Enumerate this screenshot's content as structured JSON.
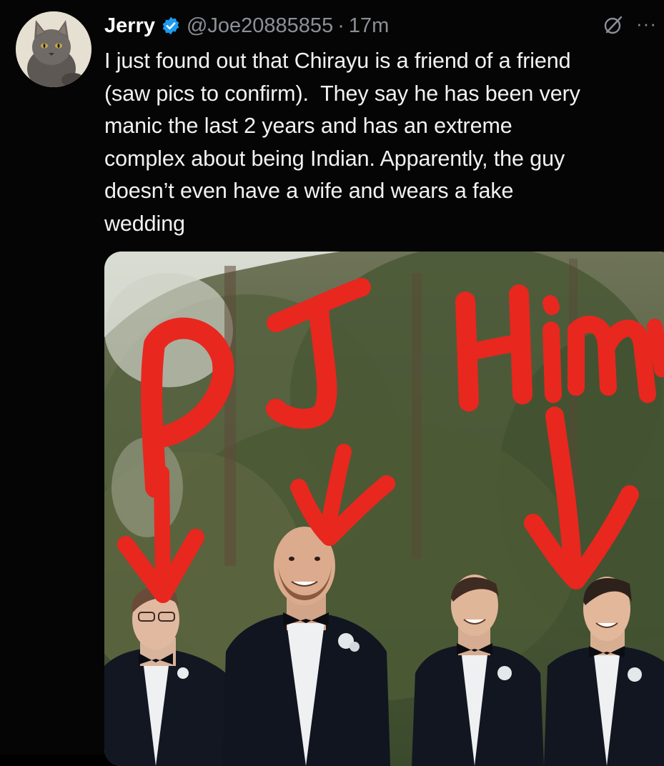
{
  "tweet": {
    "author_name": "Jerry",
    "handle": "@Joe20885855",
    "separator": "·",
    "time": "17m",
    "more_label": "···",
    "text": "I just found out that Chirayu is a friend of a friend\n(saw pics to confirm).  They say he has been very\nmanic the last 2 years and has an extreme\ncomplex about being Indian. Apparently, the guy\ndoesn’t even have a wife and wears a fake\nwedding",
    "verified_color": "#1d9bf0",
    "media": {
      "annotations": [
        "P",
        "J",
        "Him"
      ],
      "annotation_color": "#e8271f"
    }
  },
  "icons": {
    "verified": "verified-badge-icon",
    "grok": "grok-icon",
    "more": "more-options-icon"
  }
}
